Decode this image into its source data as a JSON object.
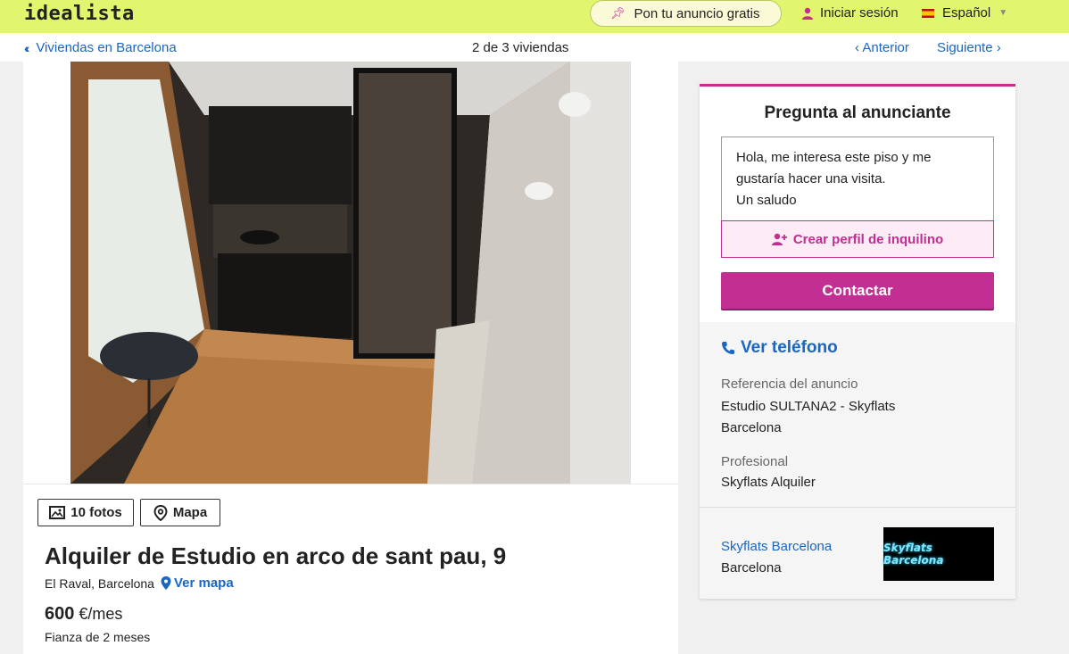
{
  "header": {
    "logo": "idealista",
    "publish_label": "Pon tu anuncio gratis",
    "login_label": "Iniciar sesión",
    "language_label": "Español"
  },
  "nav": {
    "back_label": "Viviendas en Barcelona",
    "pager": "2 de 3 viviendas",
    "prev_label": "Anterior",
    "next_label": "Siguiente"
  },
  "listing": {
    "photos_label": "10 fotos",
    "map_label": "Mapa",
    "title": "Alquiler de Estudio en arco de sant pau, 9",
    "location": "El Raval, Barcelona",
    "see_map_label": "Ver mapa",
    "price_value": "600",
    "price_unit": "€/mes",
    "deposit": "Fianza de 2 meses"
  },
  "contact": {
    "heading": "Pregunta al anunciante",
    "message": "Hola, me interesa este piso y me gustaría hacer una visita.\nUn saludo",
    "tenant_profile_label": "Crear perfil de inquilino",
    "contact_label": "Contactar",
    "phone_label": "Ver teléfono",
    "reference_label": "Referencia del anuncio",
    "reference_value": "Estudio SULTANA2 - Skyflats Barcelona",
    "professional_label": "Profesional",
    "professional_value": "Skyflats Alquiler",
    "agency_name": "Skyflats Barcelona",
    "agency_city": "Barcelona",
    "agency_logo_text": "Skyflats Barcelona"
  },
  "colors": {
    "brand_bar": "#e1f56e",
    "accent": "#c22e91",
    "link": "#1a66c3"
  }
}
